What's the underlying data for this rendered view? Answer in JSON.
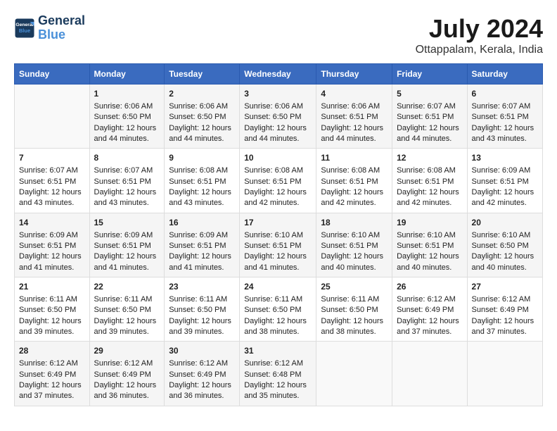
{
  "logo": {
    "line1": "General",
    "line2": "Blue"
  },
  "title": "July 2024",
  "subtitle": "Ottappalam, Kerala, India",
  "days_header": [
    "Sunday",
    "Monday",
    "Tuesday",
    "Wednesday",
    "Thursday",
    "Friday",
    "Saturday"
  ],
  "weeks": [
    [
      {
        "day": "",
        "data": ""
      },
      {
        "day": "1",
        "data": "Sunrise: 6:06 AM\nSunset: 6:50 PM\nDaylight: 12 hours\nand 44 minutes."
      },
      {
        "day": "2",
        "data": "Sunrise: 6:06 AM\nSunset: 6:50 PM\nDaylight: 12 hours\nand 44 minutes."
      },
      {
        "day": "3",
        "data": "Sunrise: 6:06 AM\nSunset: 6:50 PM\nDaylight: 12 hours\nand 44 minutes."
      },
      {
        "day": "4",
        "data": "Sunrise: 6:06 AM\nSunset: 6:51 PM\nDaylight: 12 hours\nand 44 minutes."
      },
      {
        "day": "5",
        "data": "Sunrise: 6:07 AM\nSunset: 6:51 PM\nDaylight: 12 hours\nand 44 minutes."
      },
      {
        "day": "6",
        "data": "Sunrise: 6:07 AM\nSunset: 6:51 PM\nDaylight: 12 hours\nand 43 minutes."
      }
    ],
    [
      {
        "day": "7",
        "data": "Sunrise: 6:07 AM\nSunset: 6:51 PM\nDaylight: 12 hours\nand 43 minutes."
      },
      {
        "day": "8",
        "data": "Sunrise: 6:07 AM\nSunset: 6:51 PM\nDaylight: 12 hours\nand 43 minutes."
      },
      {
        "day": "9",
        "data": "Sunrise: 6:08 AM\nSunset: 6:51 PM\nDaylight: 12 hours\nand 43 minutes."
      },
      {
        "day": "10",
        "data": "Sunrise: 6:08 AM\nSunset: 6:51 PM\nDaylight: 12 hours\nand 42 minutes."
      },
      {
        "day": "11",
        "data": "Sunrise: 6:08 AM\nSunset: 6:51 PM\nDaylight: 12 hours\nand 42 minutes."
      },
      {
        "day": "12",
        "data": "Sunrise: 6:08 AM\nSunset: 6:51 PM\nDaylight: 12 hours\nand 42 minutes."
      },
      {
        "day": "13",
        "data": "Sunrise: 6:09 AM\nSunset: 6:51 PM\nDaylight: 12 hours\nand 42 minutes."
      }
    ],
    [
      {
        "day": "14",
        "data": "Sunrise: 6:09 AM\nSunset: 6:51 PM\nDaylight: 12 hours\nand 41 minutes."
      },
      {
        "day": "15",
        "data": "Sunrise: 6:09 AM\nSunset: 6:51 PM\nDaylight: 12 hours\nand 41 minutes."
      },
      {
        "day": "16",
        "data": "Sunrise: 6:09 AM\nSunset: 6:51 PM\nDaylight: 12 hours\nand 41 minutes."
      },
      {
        "day": "17",
        "data": "Sunrise: 6:10 AM\nSunset: 6:51 PM\nDaylight: 12 hours\nand 41 minutes."
      },
      {
        "day": "18",
        "data": "Sunrise: 6:10 AM\nSunset: 6:51 PM\nDaylight: 12 hours\nand 40 minutes."
      },
      {
        "day": "19",
        "data": "Sunrise: 6:10 AM\nSunset: 6:51 PM\nDaylight: 12 hours\nand 40 minutes."
      },
      {
        "day": "20",
        "data": "Sunrise: 6:10 AM\nSunset: 6:50 PM\nDaylight: 12 hours\nand 40 minutes."
      }
    ],
    [
      {
        "day": "21",
        "data": "Sunrise: 6:11 AM\nSunset: 6:50 PM\nDaylight: 12 hours\nand 39 minutes."
      },
      {
        "day": "22",
        "data": "Sunrise: 6:11 AM\nSunset: 6:50 PM\nDaylight: 12 hours\nand 39 minutes."
      },
      {
        "day": "23",
        "data": "Sunrise: 6:11 AM\nSunset: 6:50 PM\nDaylight: 12 hours\nand 39 minutes."
      },
      {
        "day": "24",
        "data": "Sunrise: 6:11 AM\nSunset: 6:50 PM\nDaylight: 12 hours\nand 38 minutes."
      },
      {
        "day": "25",
        "data": "Sunrise: 6:11 AM\nSunset: 6:50 PM\nDaylight: 12 hours\nand 38 minutes."
      },
      {
        "day": "26",
        "data": "Sunrise: 6:12 AM\nSunset: 6:49 PM\nDaylight: 12 hours\nand 37 minutes."
      },
      {
        "day": "27",
        "data": "Sunrise: 6:12 AM\nSunset: 6:49 PM\nDaylight: 12 hours\nand 37 minutes."
      }
    ],
    [
      {
        "day": "28",
        "data": "Sunrise: 6:12 AM\nSunset: 6:49 PM\nDaylight: 12 hours\nand 37 minutes."
      },
      {
        "day": "29",
        "data": "Sunrise: 6:12 AM\nSunset: 6:49 PM\nDaylight: 12 hours\nand 36 minutes."
      },
      {
        "day": "30",
        "data": "Sunrise: 6:12 AM\nSunset: 6:49 PM\nDaylight: 12 hours\nand 36 minutes."
      },
      {
        "day": "31",
        "data": "Sunrise: 6:12 AM\nSunset: 6:48 PM\nDaylight: 12 hours\nand 35 minutes."
      },
      {
        "day": "",
        "data": ""
      },
      {
        "day": "",
        "data": ""
      },
      {
        "day": "",
        "data": ""
      }
    ]
  ]
}
